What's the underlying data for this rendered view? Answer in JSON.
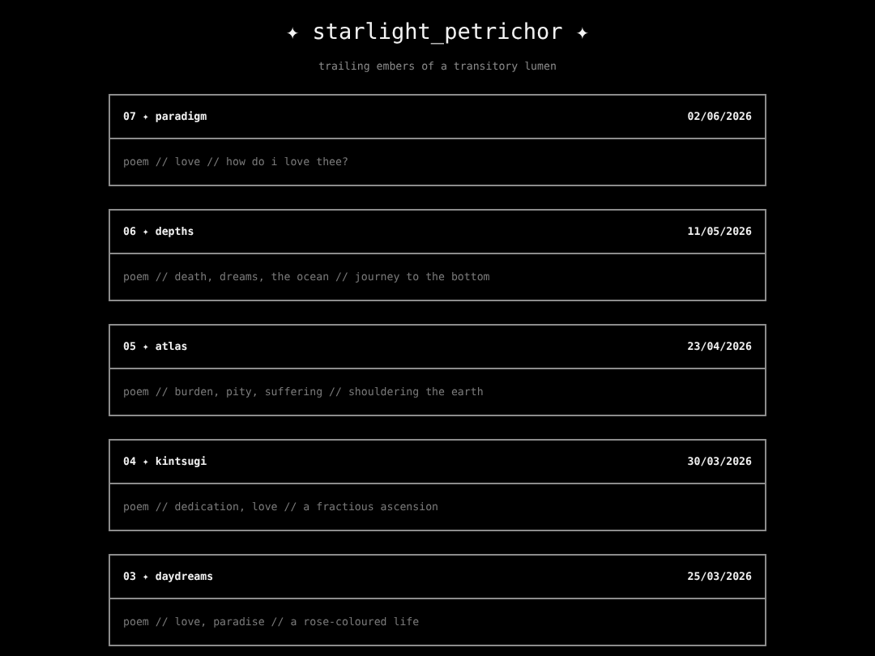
{
  "header": {
    "title": "✦ starlight_petrichor ✦",
    "subtitle": "trailing embers of a transitory lumen"
  },
  "posts": [
    {
      "heading": "07 ✦ paradigm",
      "date": "02/06/2026",
      "summary": "poem // love // how do i love thee?"
    },
    {
      "heading": "06 ✦ depths",
      "date": "11/05/2026",
      "summary": "poem // death, dreams, the ocean // journey to the bottom"
    },
    {
      "heading": "05 ✦ atlas",
      "date": "23/04/2026",
      "summary": "poem // burden, pity, suffering // shouldering the earth"
    },
    {
      "heading": "04 ✦ kintsugi",
      "date": "30/03/2026",
      "summary": "poem // dedication, love // a fractious ascension"
    },
    {
      "heading": "03 ✦ daydreams",
      "date": "25/03/2026",
      "summary": "poem // love, paradise // a rose-coloured life"
    }
  ]
}
